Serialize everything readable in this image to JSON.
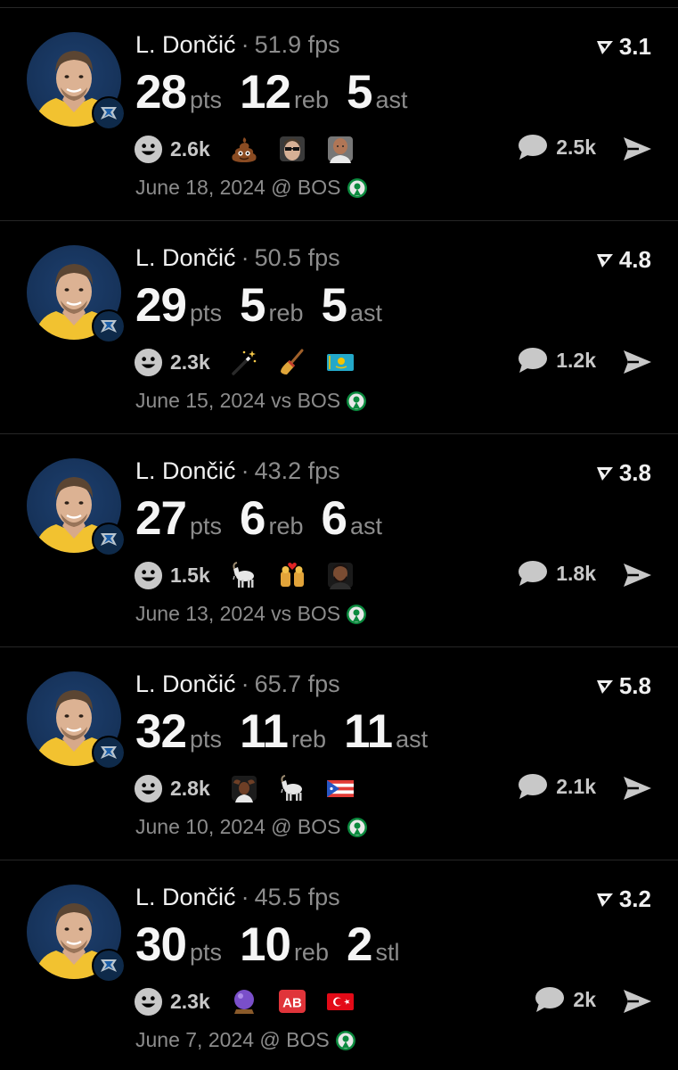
{
  "posts": [
    {
      "player": "L. Dončić",
      "separator": "·",
      "fps": "51.9 fps",
      "rating": "3.1",
      "stats": [
        {
          "value": "28",
          "unit": "pts"
        },
        {
          "value": "12",
          "unit": "reb"
        },
        {
          "value": "5",
          "unit": "ast"
        }
      ],
      "reactions": "2.6k",
      "emojis": [
        "poop-emoji",
        "sunglasses-face-emoji",
        "bald-man-emoji"
      ],
      "comments": "2.5k",
      "date": "June 18, 2024 @ BOS"
    },
    {
      "player": "L. Dončić",
      "separator": "·",
      "fps": "50.5 fps",
      "rating": "4.8",
      "stats": [
        {
          "value": "29",
          "unit": "pts"
        },
        {
          "value": "5",
          "unit": "reb"
        },
        {
          "value": "5",
          "unit": "ast"
        }
      ],
      "reactions": "2.3k",
      "emojis": [
        "magic-wand-emoji",
        "broom-emoji",
        "kazakhstan-flag-emoji"
      ],
      "comments": "1.2k",
      "date": "June 15, 2024 vs BOS"
    },
    {
      "player": "L. Dončić",
      "separator": "·",
      "fps": "43.2 fps",
      "rating": "3.8",
      "stats": [
        {
          "value": "27",
          "unit": "pts"
        },
        {
          "value": "6",
          "unit": "reb"
        },
        {
          "value": "6",
          "unit": "ast"
        }
      ],
      "reactions": "1.5k",
      "emojis": [
        "goat-emoji",
        "couple-heart-emoji",
        "bearded-man-emoji"
      ],
      "comments": "1.8k",
      "date": "June 13, 2024 vs BOS"
    },
    {
      "player": "L. Dončić",
      "separator": "·",
      "fps": "65.7 fps",
      "rating": "5.8",
      "stats": [
        {
          "value": "32",
          "unit": "pts"
        },
        {
          "value": "11",
          "unit": "reb"
        },
        {
          "value": "11",
          "unit": "ast"
        }
      ],
      "reactions": "2.8k",
      "emojis": [
        "man-hands-on-head-emoji",
        "goat-emoji",
        "puerto-rico-flag-emoji"
      ],
      "comments": "2.1k",
      "date": "June 10, 2024 @ BOS"
    },
    {
      "player": "L. Dončić",
      "separator": "·",
      "fps": "45.5 fps",
      "rating": "3.2",
      "stats": [
        {
          "value": "30",
          "unit": "pts"
        },
        {
          "value": "10",
          "unit": "reb"
        },
        {
          "value": "2",
          "unit": "stl"
        }
      ],
      "reactions": "2.3k",
      "emojis": [
        "crystal-ball-emoji",
        "ab-button-emoji",
        "turkey-flag-emoji"
      ],
      "comments": "2k",
      "date": "June 7, 2024 @ BOS"
    }
  ],
  "colors": {
    "background": "#000000",
    "muted": "#8c8c8c",
    "count": "#c8c8c8",
    "divider": "#262626"
  }
}
